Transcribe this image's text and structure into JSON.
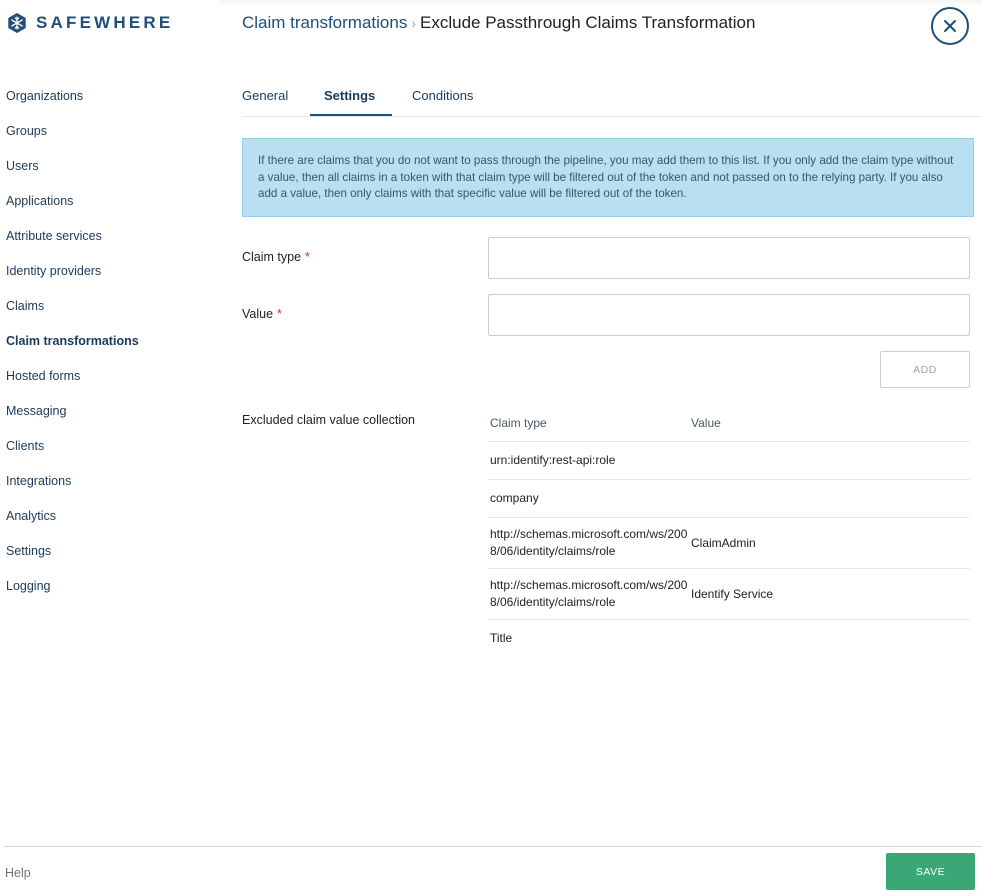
{
  "app": {
    "logo_text": "SAFEWHERE"
  },
  "sidebar": {
    "items": [
      {
        "label": "Organizations"
      },
      {
        "label": "Groups"
      },
      {
        "label": "Users"
      },
      {
        "label": "Applications"
      },
      {
        "label": "Attribute services"
      },
      {
        "label": "Identity providers"
      },
      {
        "label": "Claims"
      },
      {
        "label": "Claim transformations",
        "active": true
      },
      {
        "label": "Hosted forms"
      },
      {
        "label": "Messaging"
      },
      {
        "label": "Clients"
      },
      {
        "label": "Integrations"
      },
      {
        "label": "Analytics"
      },
      {
        "label": "Settings"
      },
      {
        "label": "Logging"
      }
    ]
  },
  "header": {
    "breadcrumb_parent": "Claim transformations",
    "breadcrumb_separator": "›",
    "title": "Exclude Passthrough Claims Transformation",
    "close_icon": "close-icon"
  },
  "tabs": [
    {
      "label": "General"
    },
    {
      "label": "Settings",
      "active": true
    },
    {
      "label": "Conditions"
    }
  ],
  "info": {
    "text": "If there are claims that you do not want to pass through the pipeline, you may add them to this list. If you only add the claim type without a value, then all claims in a token with that claim type will be filtered out of the token and not passed on to the relying party. If you also add a value, then only claims with that specific value will be filtered out of the token."
  },
  "form": {
    "claim_type": {
      "label": "Claim type",
      "required_mark": "*",
      "value": "",
      "placeholder": ""
    },
    "value": {
      "label": "Value",
      "required_mark": "*",
      "value": "",
      "placeholder": ""
    },
    "add_label": "ADD"
  },
  "collection": {
    "label": "Excluded claim value collection",
    "columns": {
      "type": "Claim type",
      "value": "Value"
    },
    "rows": [
      {
        "type": "urn:identify:rest-api:role",
        "value": ""
      },
      {
        "type": "company",
        "value": ""
      },
      {
        "type": "http://schemas.microsoft.com/ws/2008/06/identity/claims/role",
        "value": "ClaimAdmin"
      },
      {
        "type": "http://schemas.microsoft.com/ws/2008/06/identity/claims/role",
        "value": "Identify Service"
      },
      {
        "type": "Title",
        "value": ""
      }
    ]
  },
  "footer": {
    "help_label": "Help",
    "save_label": "SAVE"
  },
  "colors": {
    "brand": "#1f4e79",
    "info_bg": "#b9e0f2",
    "save": "#3aa876",
    "required": "#c0392b"
  }
}
